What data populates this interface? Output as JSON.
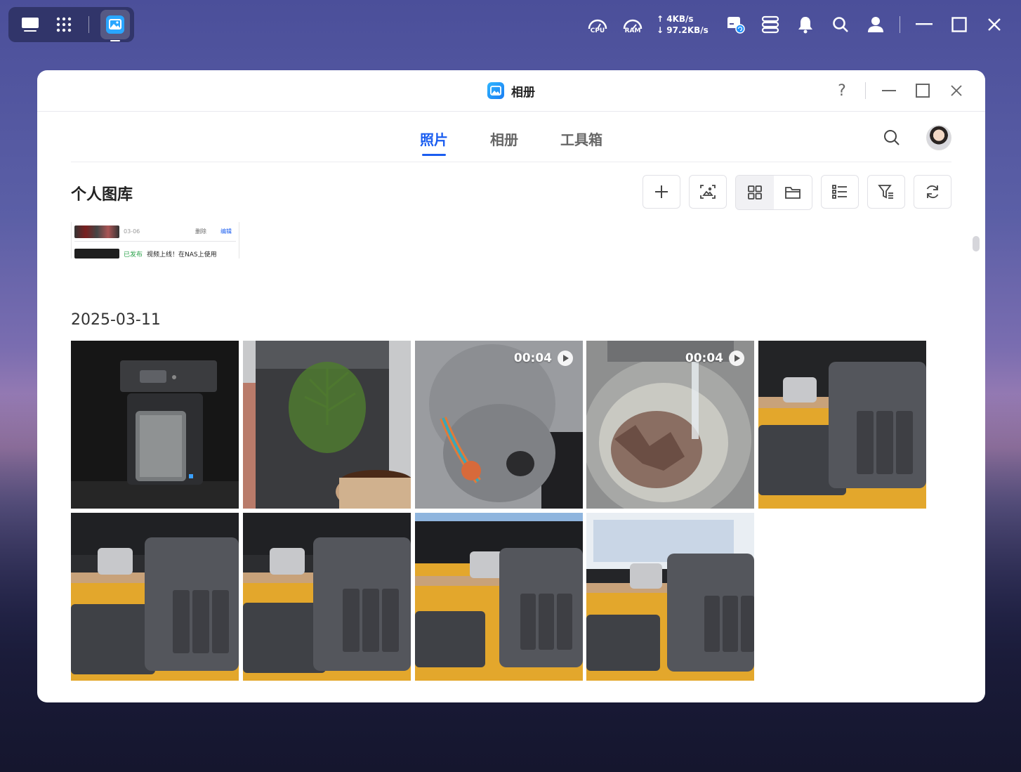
{
  "taskbar": {
    "cpu_label": "CPU",
    "ram_label": "RAM",
    "upload": "↑ 4KB/s",
    "download": "↓ 97.2KB/s"
  },
  "window": {
    "title": "相册",
    "help": "?"
  },
  "nav": {
    "tabs": [
      {
        "label": "照片",
        "active": true
      },
      {
        "label": "相册",
        "active": false
      },
      {
        "label": "工具箱",
        "active": false
      }
    ]
  },
  "library": {
    "title": "个人图库"
  },
  "embedded_card": {
    "date": "03-06",
    "delete": "删除",
    "edit": "编辑",
    "tag": "已发布",
    "text": "视频上线！在NAS上使用"
  },
  "group": {
    "date": "2025-03-11",
    "photos": [
      {
        "scene": "nas-black-closeup"
      },
      {
        "scene": "nas-with-plant"
      },
      {
        "scene": "dog",
        "duration": "00:04"
      },
      {
        "scene": "food-bowl",
        "duration": "00:04"
      },
      {
        "scene": "nas-desk-1"
      },
      {
        "scene": "nas-desk-2"
      },
      {
        "scene": "nas-desk-3"
      },
      {
        "scene": "nas-desk-4"
      },
      {
        "scene": "nas-desk-5"
      }
    ]
  },
  "colors": {
    "accent": "#1a5df0",
    "desk_yellow": "#e3a72c"
  }
}
